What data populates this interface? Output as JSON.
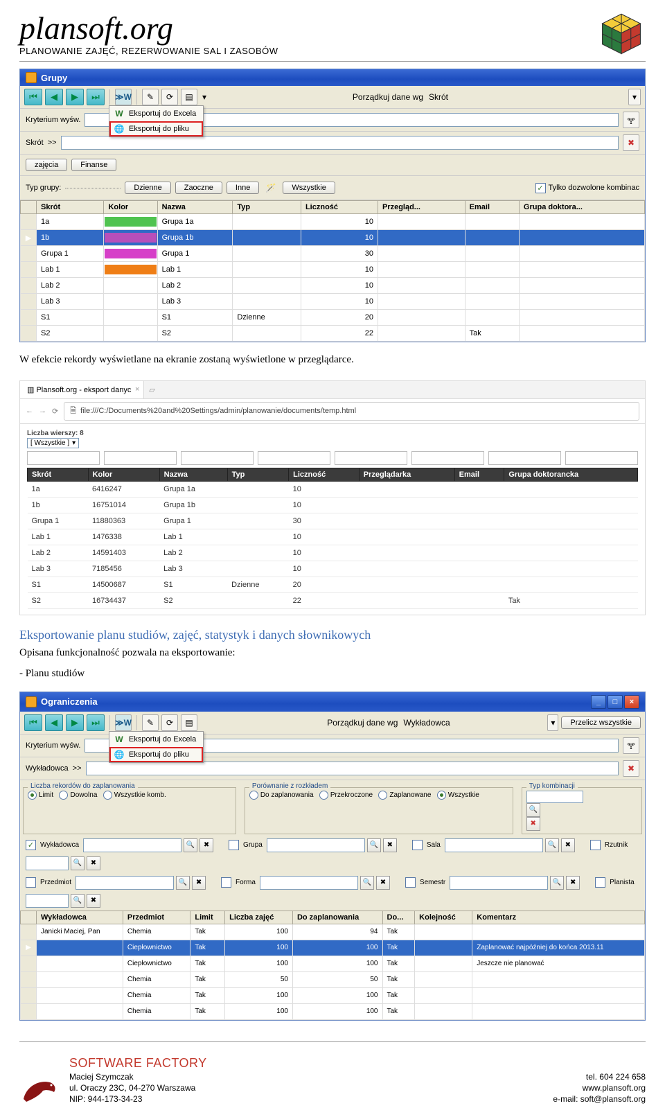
{
  "brand": {
    "name": "plansoft.org",
    "subtitle": "PLANOWANIE ZAJĘĆ, REZERWOWANIE SAL I ZASOBÓW"
  },
  "win1": {
    "title": "Grupy",
    "sort_label": "Porządkuj dane wg",
    "sort_value": "Skrót",
    "crit_label": "Kryterium wyśw.",
    "skrot_label": "Skrót",
    "skrot_chev": ">>",
    "dropdown": {
      "excel": "Eksportuj do Excela",
      "file": "Eksportuj do pliku"
    },
    "tab1": "zajęcia",
    "tab2": "Finanse",
    "type_label": "Typ grupy:",
    "b_dzienne": "Dzienne",
    "b_zaoczne": "Zaoczne",
    "b_inne": "Inne",
    "b_all": "Wszystkie",
    "chk_label": "Tylko dozwolone kombinac",
    "cols": {
      "skrot": "Skrót",
      "kolor": "Kolor",
      "nazwa": "Nazwa",
      "typ": "Typ",
      "licz": "Liczność",
      "prz": "Przegląd...",
      "email": "Email",
      "gd": "Grupa doktora..."
    },
    "rows": [
      {
        "skrot": "1a",
        "color": "#50c350",
        "nazwa": "Grupa 1a",
        "typ": "",
        "licz": "10",
        "prz": "",
        "email": "",
        "gd": ""
      },
      {
        "skrot": "1b",
        "color": "#b84fba",
        "nazwa": "Grupa 1b",
        "typ": "",
        "licz": "10",
        "prz": "",
        "email": "",
        "gd": "",
        "sel": true
      },
      {
        "skrot": "Grupa 1",
        "color": "#d63fc8",
        "nazwa": "Grupa 1",
        "typ": "",
        "licz": "30",
        "prz": "",
        "email": "",
        "gd": ""
      },
      {
        "skrot": "Lab 1",
        "color": "#ef7e16",
        "nazwa": "Lab 1",
        "typ": "",
        "licz": "10",
        "prz": "",
        "email": "",
        "gd": ""
      },
      {
        "skrot": "Lab 2",
        "color": "#ffffff",
        "nazwa": "Lab 2",
        "typ": "",
        "licz": "10",
        "prz": "",
        "email": "",
        "gd": ""
      },
      {
        "skrot": "Lab 3",
        "color": "#ffffff",
        "nazwa": "Lab 3",
        "typ": "",
        "licz": "10",
        "prz": "",
        "email": "",
        "gd": ""
      },
      {
        "skrot": "S1",
        "color": "#ffffff",
        "nazwa": "S1",
        "typ": "Dzienne",
        "licz": "20",
        "prz": "",
        "email": "",
        "gd": ""
      },
      {
        "skrot": "S2",
        "color": "#ffffff",
        "nazwa": "S2",
        "typ": "",
        "licz": "22",
        "prz": "",
        "email": "Tak",
        "gd": ""
      }
    ]
  },
  "p1": "W efekcie rekordy wyświetlane na ekranie zostaną wyświetlone w przeglądarce.",
  "browser": {
    "tab": "Plansoft.org - eksport danyc",
    "url": "file:///C:/Documents%20and%20Settings/admin/planowanie/documents/temp.html",
    "count_label": "Liczba wierszy:",
    "count": "8",
    "filter_all": "[ Wszystkie ]",
    "cols": {
      "skrot": "Skrót",
      "kolor": "Kolor",
      "nazwa": "Nazwa",
      "typ": "Typ",
      "licz": "Liczność",
      "prz": "Przeglądarka",
      "email": "Email",
      "gd": "Grupa doktorancka"
    },
    "rows": [
      {
        "skrot": "1a",
        "kolor": "6416247",
        "nazwa": "Grupa 1a",
        "typ": "",
        "licz": "10",
        "prz": "",
        "email": "",
        "gd": ""
      },
      {
        "skrot": "1b",
        "kolor": "16751014",
        "nazwa": "Grupa 1b",
        "typ": "",
        "licz": "10",
        "prz": "",
        "email": "",
        "gd": ""
      },
      {
        "skrot": "Grupa 1",
        "kolor": "11880363",
        "nazwa": "Grupa 1",
        "typ": "",
        "licz": "30",
        "prz": "",
        "email": "",
        "gd": ""
      },
      {
        "skrot": "Lab 1",
        "kolor": "1476338",
        "nazwa": "Lab 1",
        "typ": "",
        "licz": "10",
        "prz": "",
        "email": "",
        "gd": ""
      },
      {
        "skrot": "Lab 2",
        "kolor": "14591403",
        "nazwa": "Lab 2",
        "typ": "",
        "licz": "10",
        "prz": "",
        "email": "",
        "gd": ""
      },
      {
        "skrot": "Lab 3",
        "kolor": "7185456",
        "nazwa": "Lab 3",
        "typ": "",
        "licz": "10",
        "prz": "",
        "email": "",
        "gd": ""
      },
      {
        "skrot": "S1",
        "kolor": "14500687",
        "nazwa": "S1",
        "typ": "Dzienne",
        "licz": "20",
        "prz": "",
        "email": "",
        "gd": ""
      },
      {
        "skrot": "S2",
        "kolor": "16734437",
        "nazwa": "S2",
        "typ": "",
        "licz": "22",
        "prz": "",
        "email": "",
        "gd": "Tak"
      }
    ]
  },
  "h2": "Eksportowanie planu studiów, zajęć, statystyk i danych słownikowych",
  "p2": "Opisana funkcjonalność pozwala na eksportowanie:",
  "p3": "- Planu studiów",
  "win2": {
    "title": "Ograniczenia",
    "sort_label": "Porządkuj dane wg",
    "sort_value": "Wykładowca",
    "recalc": "Przelicz wszystkie",
    "crit_label": "Kryterium wyśw.",
    "wyk_label": "Wykładowca",
    "skrot_chev": ">>",
    "dropdown": {
      "excel": "Eksportuj do Excela",
      "file": "Eksportuj do pliku"
    },
    "fs1": {
      "title": "Liczba rekordów do zaplanowania",
      "r1": "Limit",
      "r2": "Dowolna",
      "r3": "Wszystkie komb."
    },
    "fs2": {
      "title": "Porównanie z rozkładem",
      "r1": "Do zaplanowania",
      "r2": "Przekroczone",
      "r3": "Zaplanowane",
      "r4": "Wszystkie"
    },
    "fs3": {
      "title": "Typ kombinacji"
    },
    "combos": {
      "c1": "Wykładowca",
      "c2": "Grupa",
      "c3": "Sala",
      "c4": "Rzutnik",
      "c5": "Przedmiot",
      "c6": "Forma",
      "c7": "Semestr",
      "c8": "Planista"
    },
    "cols": {
      "wyk": "Wykładowca",
      "prz": "Przedmiot",
      "lim": "Limit",
      "lz": "Liczba zajęć",
      "dz": "Do zaplanowania",
      "do": "Do...",
      "kol": "Kolejność",
      "kom": "Komentarz"
    },
    "rows": [
      {
        "wyk": "Janicki Maciej, Pan",
        "prz": "Chemia",
        "lim": "Tak",
        "lz": "100",
        "dz": "94",
        "do": "Tak",
        "kol": "",
        "kom": ""
      },
      {
        "wyk": "",
        "prz": "Ciepłownictwo",
        "lim": "Tak",
        "lz": "100",
        "dz": "100",
        "do": "Tak",
        "kol": "",
        "kom": "Zaplanować najpóźniej do końca 2013.11",
        "sel": true
      },
      {
        "wyk": "",
        "prz": "Ciepłownictwo",
        "lim": "Tak",
        "lz": "100",
        "dz": "100",
        "do": "Tak",
        "kol": "",
        "kom": "Jeszcze nie planować"
      },
      {
        "wyk": "",
        "prz": "Chemia",
        "lim": "Tak",
        "lz": "50",
        "dz": "50",
        "do": "Tak",
        "kol": "",
        "kom": ""
      },
      {
        "wyk": "",
        "prz": "Chemia",
        "lim": "Tak",
        "lz": "100",
        "dz": "100",
        "do": "Tak",
        "kol": "",
        "kom": ""
      },
      {
        "wyk": "",
        "prz": "Chemia",
        "lim": "Tak",
        "lz": "100",
        "dz": "100",
        "do": "Tak",
        "kol": "",
        "kom": ""
      }
    ]
  },
  "footer": {
    "sf": "SOFTWARE FACTORY",
    "name": "Maciej Szymczak",
    "addr": "ul. Oraczy 23C, 04-270 Warszawa",
    "nip": "NIP: 944-173-34-23",
    "tel": "tel. 604 224 658",
    "www": "www.plansoft.org",
    "email": "e-mail: soft@plansoft.org"
  }
}
